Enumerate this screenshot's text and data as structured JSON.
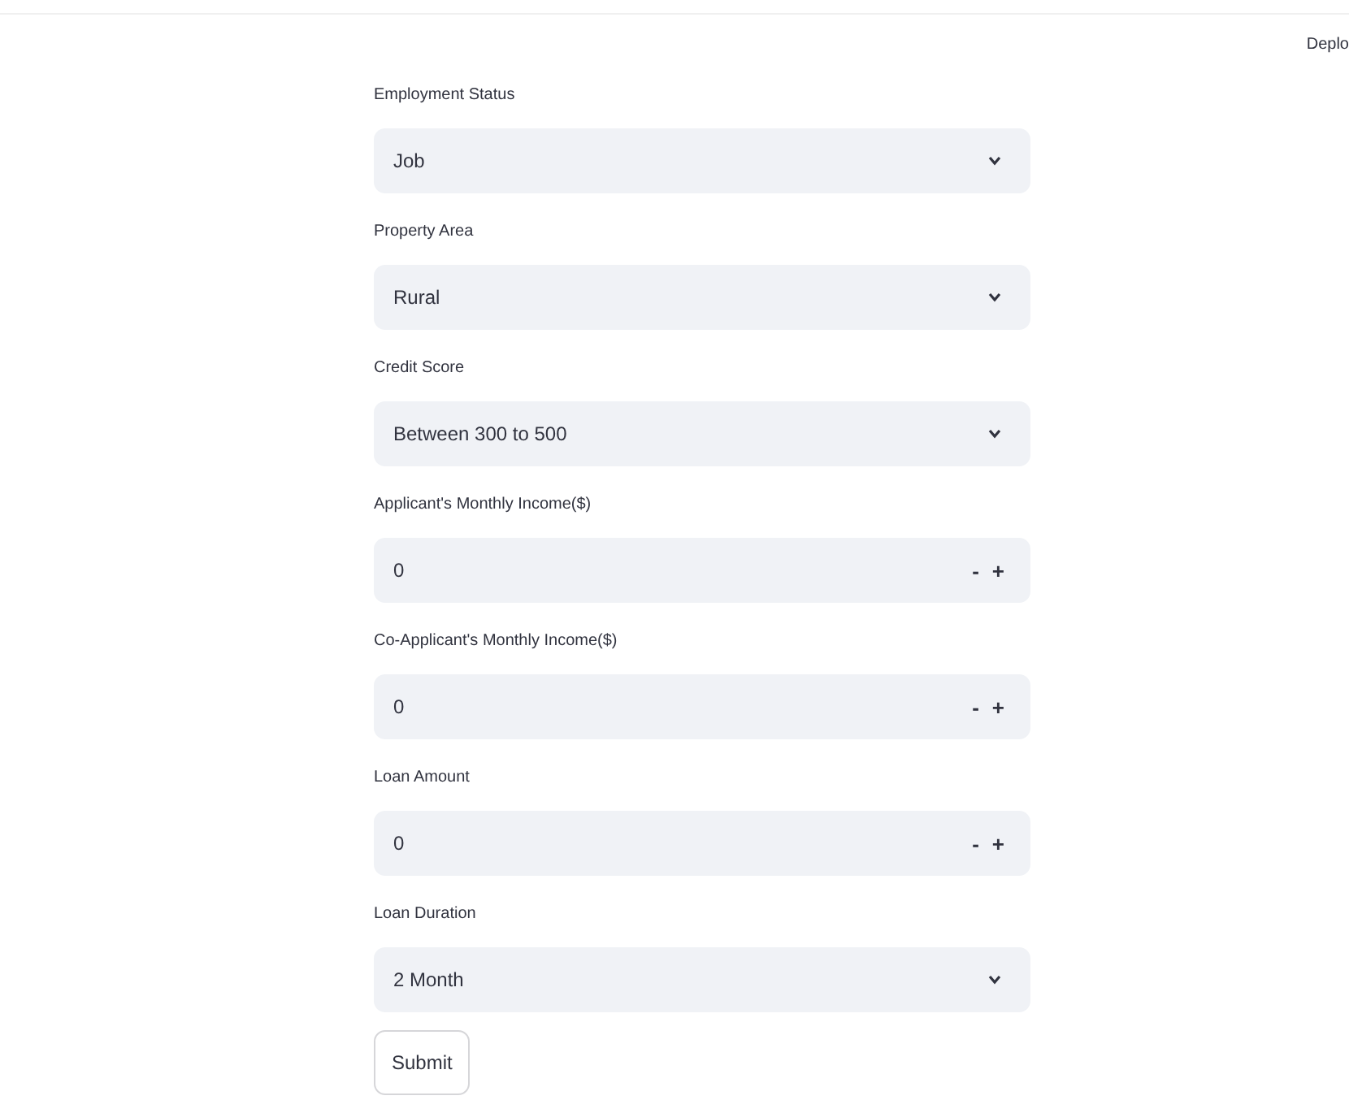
{
  "header": {
    "action": "Deplo"
  },
  "fields": [
    {
      "kind": "select",
      "label": "Employment Status",
      "value": "Job"
    },
    {
      "kind": "select",
      "label": "Property Area",
      "value": "Rural"
    },
    {
      "kind": "select",
      "label": "Credit Score",
      "value": "Between 300 to 500"
    },
    {
      "kind": "number",
      "label": "Applicant's Monthly Income($)",
      "value": "0",
      "minus": "-",
      "plus": "+"
    },
    {
      "kind": "number",
      "label": "Co-Applicant's Monthly Income($)",
      "value": "0",
      "minus": "-",
      "plus": "+"
    },
    {
      "kind": "number",
      "label": "Loan Amount",
      "value": "0",
      "minus": "-",
      "plus": "+"
    },
    {
      "kind": "select",
      "label": "Loan Duration",
      "value": "2 Month"
    }
  ],
  "submit": "Submit"
}
